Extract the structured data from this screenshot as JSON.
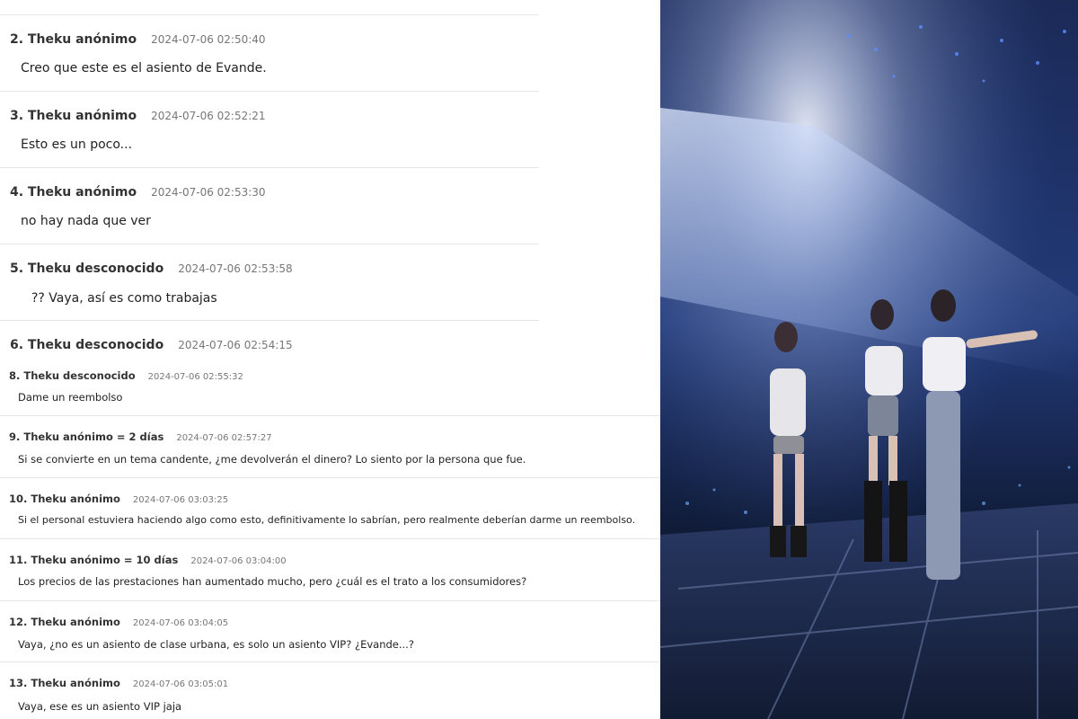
{
  "comments": [
    {
      "author": "2. Theku anónimo",
      "date": "2024-07-06 02:50:40",
      "text": "Creo que este es el asiento de Evande."
    },
    {
      "author": "3. Theku anónimo",
      "date": "2024-07-06 02:52:21",
      "text": "Esto es un poco..."
    },
    {
      "author": "4. Theku anónimo",
      "date": "2024-07-06 02:53:30",
      "text": "no hay nada que ver"
    },
    {
      "author": "5. Theku desconocido",
      "date": "2024-07-06 02:53:58",
      "text": "?? Vaya, así es como trabajas"
    },
    {
      "author": "6. Theku desconocido",
      "date": "2024-07-06 02:54:15"
    },
    {
      "author": "8. Theku desconocido",
      "date": "2024-07-06 02:55:32",
      "text": "Dame un reembolso"
    },
    {
      "author": "9. Theku anónimo = 2 días",
      "date": "2024-07-06 02:57:27",
      "text": "Si se convierte en un tema candente, ¿me devolverán el dinero? Lo siento por la persona que fue."
    },
    {
      "author": "10. Theku anónimo",
      "date": "2024-07-06 03:03:25",
      "text": "Si el personal estuviera haciendo algo como esto, definitivamente lo sabrían, pero realmente deberían darme un reembolso."
    },
    {
      "author": "11. Theku anónimo = 10 días",
      "date": "2024-07-06 03:04:00",
      "text": "Los precios de las prestaciones han aumentado mucho, pero ¿cuál es el trato a los consumidores?"
    },
    {
      "author": "12. Theku anónimo",
      "date": "2024-07-06 03:04:05",
      "text": "Vaya, ¿no es un asiento de clase urbana, es solo un asiento VIP? ¿Evande...?"
    },
    {
      "author": "13. Theku anónimo",
      "date": "2024-07-06 03:05:01",
      "text": "Vaya, ese es un asiento VIP jaja"
    }
  ]
}
